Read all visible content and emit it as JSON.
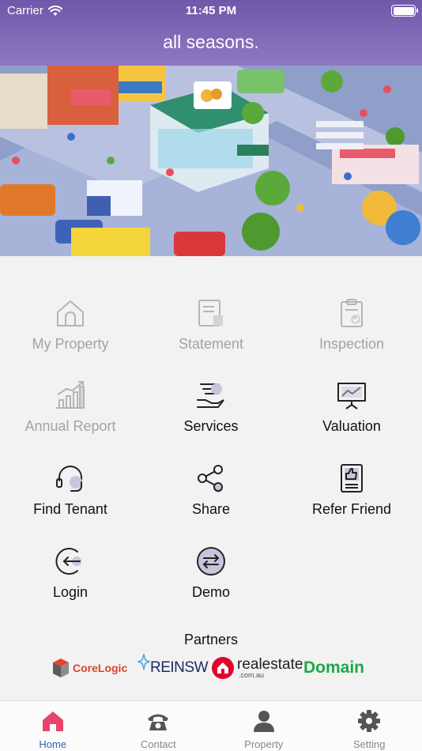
{
  "status_bar": {
    "carrier": "Carrier",
    "time": "11:45 PM"
  },
  "header": {
    "title": "all seasons."
  },
  "menu": [
    {
      "label": "My Property",
      "icon": "house-icon",
      "enabled": false
    },
    {
      "label": "Statement",
      "icon": "document-icon",
      "enabled": false
    },
    {
      "label": "Inspection",
      "icon": "clipboard-check-icon",
      "enabled": false
    },
    {
      "label": "Annual Report",
      "icon": "bar-chart-icon",
      "enabled": false
    },
    {
      "label": "Services",
      "icon": "service-hand-icon",
      "enabled": true
    },
    {
      "label": "Valuation",
      "icon": "presentation-chart-icon",
      "enabled": true
    },
    {
      "label": "Find Tenant",
      "icon": "headset-icon",
      "enabled": true
    },
    {
      "label": "Share",
      "icon": "share-icon",
      "enabled": true
    },
    {
      "label": "Refer Friend",
      "icon": "thumbs-up-icon",
      "enabled": true
    },
    {
      "label": "Login",
      "icon": "login-icon",
      "enabled": true
    },
    {
      "label": "Demo",
      "icon": "swap-icon",
      "enabled": true
    }
  ],
  "partners": {
    "title": "Partners",
    "corelogic": "CoreLogic",
    "reinsw": "REINSW",
    "realestate": "realestate",
    "realestate_sub": ".com.au",
    "domain": "Domain"
  },
  "tabs": [
    {
      "label": "Home",
      "icon": "home-icon",
      "active": true
    },
    {
      "label": "Contact",
      "icon": "phone-icon",
      "active": false
    },
    {
      "label": "Property",
      "icon": "person-icon",
      "active": false
    },
    {
      "label": "Setting",
      "icon": "gear-icon",
      "active": false
    }
  ],
  "colors": {
    "header": "#7a63b0",
    "accent": "#e8456b",
    "active_tab": "#2b67b5",
    "disabled": "#a3a3a3"
  }
}
